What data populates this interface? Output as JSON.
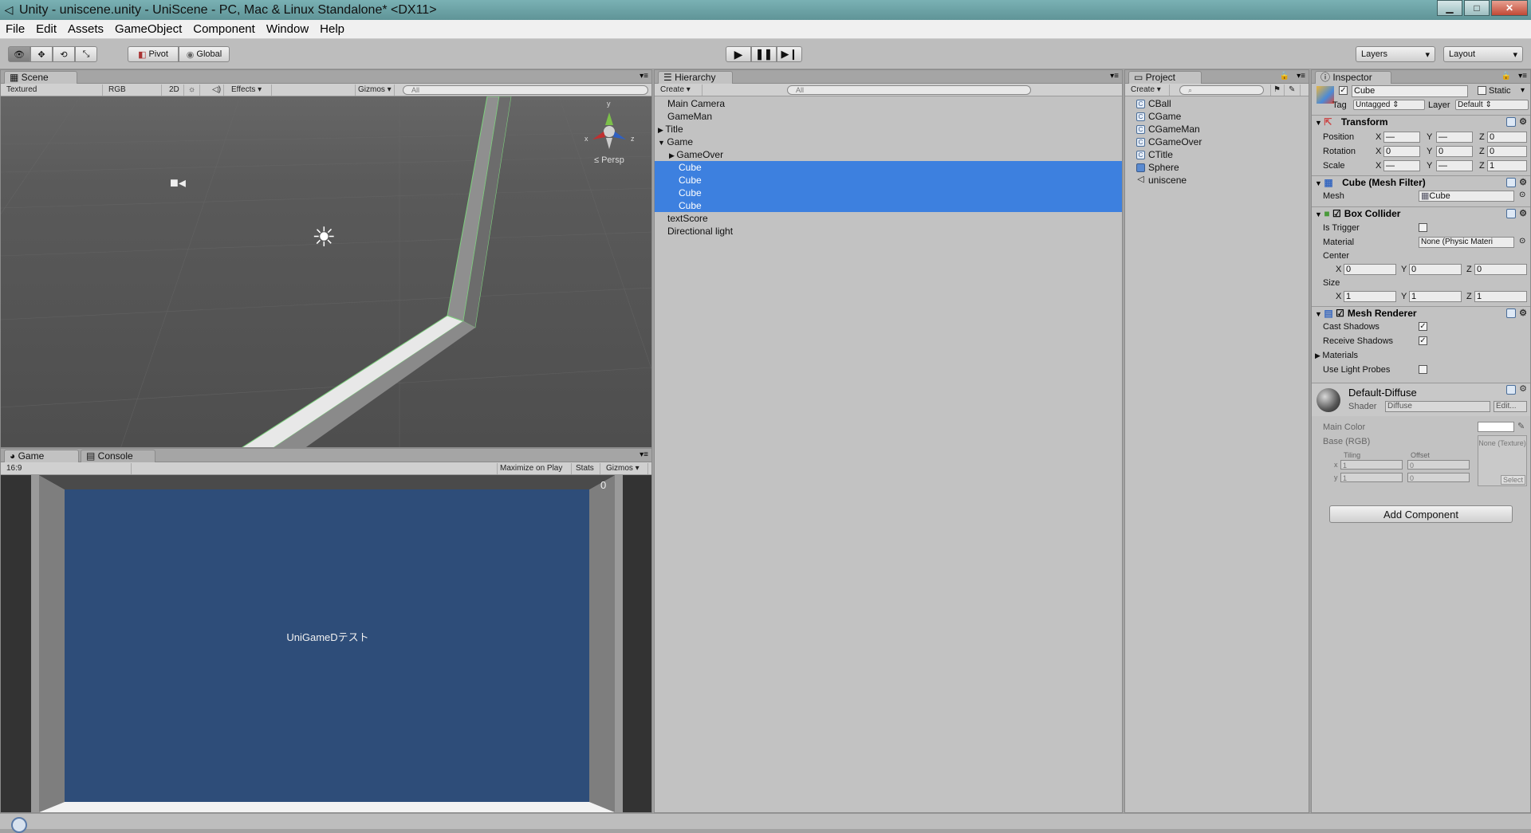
{
  "window": {
    "title": "Unity - uniscene.unity - UniScene - PC, Mac & Linux Standalone* <DX11>",
    "min": "▁",
    "max": "□",
    "close": "✕"
  },
  "menu": [
    "File",
    "Edit",
    "Assets",
    "GameObject",
    "Component",
    "Window",
    "Help"
  ],
  "toolbar": {
    "pivot": "Pivot",
    "global": "Global",
    "layers": "Layers",
    "layout": "Layout"
  },
  "scene": {
    "tab": "Scene",
    "shading": "Textured",
    "rgb": "RGB",
    "mode2d": "2D",
    "effects": "Effects",
    "gizmos": "Gizmos",
    "search_placeholder": "All",
    "persp": "Persp",
    "axis_y": "y",
    "axis_x": "x",
    "axis_z": "z"
  },
  "game": {
    "tab": "Game",
    "console_tab": "Console",
    "aspect": "16:9",
    "maximize": "Maximize on Play",
    "stats": "Stats",
    "gizmos": "Gizmos",
    "score": "0",
    "center_text": "UniGameDテスト"
  },
  "hierarchy": {
    "tab": "Hierarchy",
    "create": "Create",
    "search_placeholder": "All",
    "items": [
      {
        "label": "Main Camera"
      },
      {
        "label": "GameMan"
      },
      {
        "label": "Title"
      },
      {
        "label": "Game"
      },
      {
        "label": "GameOver"
      },
      {
        "label": "Cube"
      },
      {
        "label": "Cube"
      },
      {
        "label": "Cube"
      },
      {
        "label": "Cube"
      },
      {
        "label": "textScore"
      },
      {
        "label": "Directional light"
      }
    ]
  },
  "project": {
    "tab": "Project",
    "create": "Create",
    "items": [
      {
        "label": "CBall"
      },
      {
        "label": "CGame"
      },
      {
        "label": "CGameMan"
      },
      {
        "label": "CGameOver"
      },
      {
        "label": "CTitle"
      },
      {
        "label": "Sphere"
      },
      {
        "label": "uniscene"
      }
    ]
  },
  "inspector": {
    "tab": "Inspector",
    "object_name": "Cube",
    "static": "Static",
    "tag_label": "Tag",
    "tag": "Untagged",
    "layer_label": "Layer",
    "layer": "Default",
    "transform": {
      "title": "Transform",
      "position": "Position",
      "rotation": "Rotation",
      "scale": "Scale",
      "x": "X",
      "y": "Y",
      "z": "Z",
      "pos_x": "—",
      "pos_y": "—",
      "pos_z": "0",
      "rot_x": "0",
      "rot_y": "0",
      "rot_z": "0",
      "sc_x": "—",
      "sc_y": "—",
      "sc_z": "1"
    },
    "mesh_filter": {
      "title": "Cube (Mesh Filter)",
      "mesh_label": "Mesh",
      "mesh": "Cube"
    },
    "box_collider": {
      "title": "Box Collider",
      "is_trigger": "Is Trigger",
      "material_label": "Material",
      "material": "None (Physic Materi",
      "center": "Center",
      "size": "Size",
      "cx": "0",
      "cy": "0",
      "cz": "0",
      "sx": "1",
      "sy": "1",
      "sz": "1"
    },
    "mesh_renderer": {
      "title": "Mesh Renderer",
      "cast_shadows": "Cast Shadows",
      "receive_shadows": "Receive Shadows",
      "materials": "Materials",
      "use_light_probes": "Use Light Probes"
    },
    "material": {
      "name": "Default-Diffuse",
      "shader_label": "Shader",
      "shader": "Diffuse",
      "edit": "Edit...",
      "main_color": "Main Color",
      "base": "Base (RGB)",
      "tiling": "Tiling",
      "offset": "Offset",
      "x": "x",
      "y": "y",
      "tx": "1",
      "ty": "1",
      "ox": "0",
      "oy": "0",
      "none_texture": "None (Texture)",
      "select": "Select"
    },
    "add_component": "Add Component"
  },
  "colors": {
    "selection": "#3d80df",
    "game_bg": "#2e4d79",
    "panel": "#c2c2c2"
  }
}
